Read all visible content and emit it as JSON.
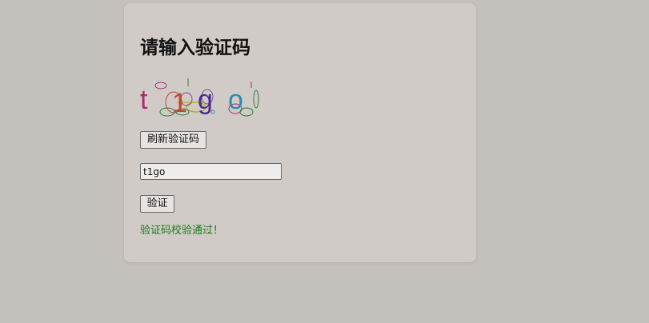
{
  "page": {
    "title": "请输入验证码"
  },
  "captcha": {
    "chars": [
      "t",
      "1",
      "g",
      "o"
    ],
    "char_colors": [
      "#b0286e",
      "#c0472f",
      "#4b2c8e",
      "#2b8db0"
    ]
  },
  "buttons": {
    "refresh_label": "刷新验证码",
    "verify_label": "验证"
  },
  "input": {
    "value": "t1go"
  },
  "result": {
    "message": "验证码校验通过！",
    "color": "#1f7a1f"
  }
}
